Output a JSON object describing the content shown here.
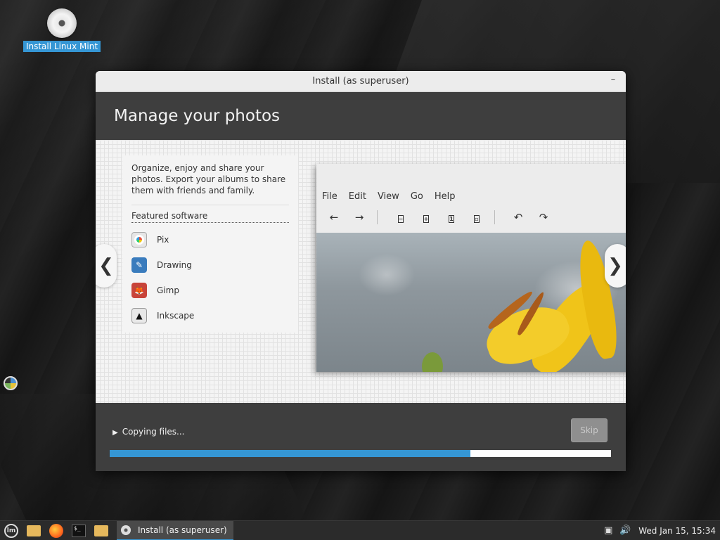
{
  "desktop": {
    "icon_label": "Install Linux Mint"
  },
  "window": {
    "title": "Install (as superuser)",
    "minimize_glyph": "–"
  },
  "slide": {
    "heading": "Manage your photos",
    "description": "Organize, enjoy and share your photos. Export your albums to share them with friends and family.",
    "featured_heading": "Featured software",
    "software": [
      {
        "name": "Pix",
        "icon": "pix-icon"
      },
      {
        "name": "Drawing",
        "icon": "drawing-icon"
      },
      {
        "name": "Gimp",
        "icon": "gimp-icon"
      },
      {
        "name": "Inkscape",
        "icon": "inkscape-icon"
      }
    ],
    "prev_glyph": "❮",
    "next_glyph": "❯",
    "mock_app": {
      "menu": [
        "File",
        "Edit",
        "View",
        "Go",
        "Help"
      ]
    }
  },
  "footer": {
    "status": "Copying files...",
    "skip_label": "Skip",
    "progress_percent": 72
  },
  "taskbar": {
    "task_label": "Install (as superuser)",
    "clock": "Wed Jan 15, 15:34"
  },
  "colors": {
    "accent": "#3596d4",
    "header_bg": "#3e3e3e"
  }
}
